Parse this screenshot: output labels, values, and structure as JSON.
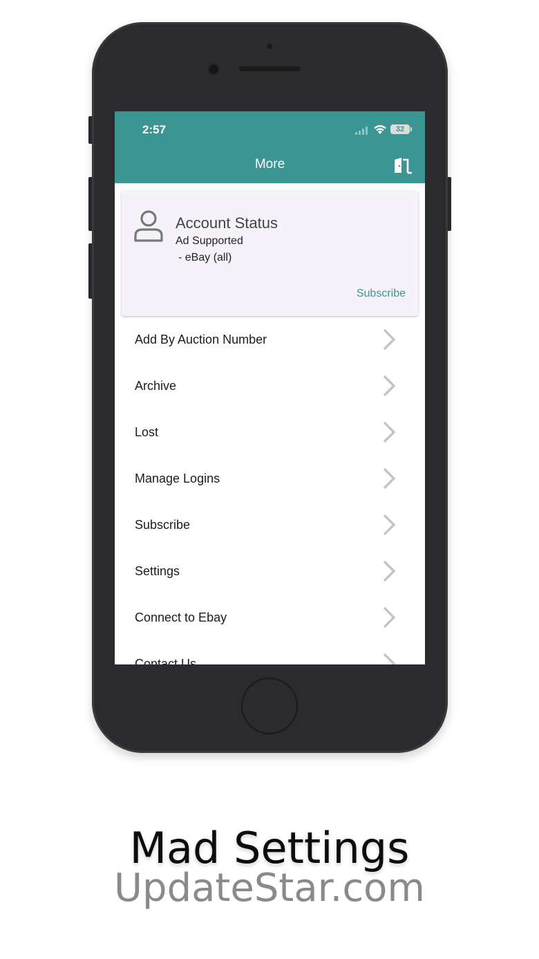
{
  "status_bar": {
    "time": "2:57",
    "battery": "32"
  },
  "nav": {
    "title": "More",
    "logout_icon": "logout-door-icon"
  },
  "account_card": {
    "icon": "person-icon",
    "title": "Account Status",
    "subtitle": "Ad Supported",
    "plan": " - eBay (all)",
    "subscribe_label": "Subscribe"
  },
  "menu": {
    "items": [
      {
        "label": "Add By Auction Number"
      },
      {
        "label": "Archive"
      },
      {
        "label": "Lost"
      },
      {
        "label": "Manage Logins"
      },
      {
        "label": "Subscribe"
      },
      {
        "label": "Settings"
      },
      {
        "label": "Connect to Ebay"
      },
      {
        "label": "Contact Us"
      }
    ]
  },
  "caption": {
    "title": "Mad Settings",
    "brand": "UpdateStar.com"
  },
  "colors": {
    "accent": "#3b9593",
    "card_bg": "#f6f2f9",
    "device": "#2b2b2d"
  }
}
